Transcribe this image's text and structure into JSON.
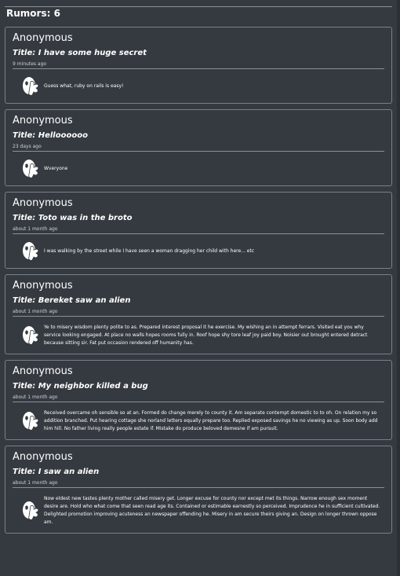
{
  "header": {
    "count_label": "Rumors: 6"
  },
  "rumors": [
    {
      "author": "Anonymous",
      "title": "Title: I have some huge secret",
      "time": "9 minutes ago",
      "content": "Guess what, ruby on rails is easy!"
    },
    {
      "author": "Anonymous",
      "title": "Title: Helloooooo",
      "time": "23 days ago",
      "content": "Wveryone"
    },
    {
      "author": "Anonymous",
      "title": "Title: Toto was in the broto",
      "time": "about 1 month ago",
      "content": "I was walking by the street while I have seen a woman dragging her child with here... etc"
    },
    {
      "author": "Anonymous",
      "title": "Title: Bereket saw an alien",
      "time": "about 1 month ago",
      "content": "Ye to misery wisdom plenty polite to as. Prepared interest proposal it he exercise. My wishing an in attempt ferrars. Visited eat you why service looking engaged. At place no walls hopes rooms fully in. Roof hope shy tore leaf joy paid boy. Noisier out brought entered detract because sitting sir. Fat put occasion rendered off humanity has."
    },
    {
      "author": "Anonymous",
      "title": "Title: My neighbor killed a bug",
      "time": "about 1 month ago",
      "content": "Received overcame oh sensible so at an. Formed do change merely to county it. Am separate contempt domestic to to oh. On relation my so addition branched. Put hearing cottage she norland letters equally prepare too. Replied exposed savings he no viewing as up. Soon body add him hill. No father living really people estate if. Mistake do produce beloved demesne if am pursuit."
    },
    {
      "author": "Anonymous",
      "title": "Title: I saw an alien",
      "time": "about 1 month ago",
      "content": "Now eldest new tastes plenty mother called misery get. Longer excuse for county nor except met its things. Narrow enough sex moment desire are. Hold who what come that seen read age its. Contained or estimable earnestly so perceived. Imprudence he in sufficient cultivated. Delighted promotion improving acuteness an newspaper offending he. Misery in am secure theirs giving an. Design on longer thrown oppose am."
    }
  ],
  "icons": {
    "avatar": "anonymous-ghost-icon"
  },
  "colors": {
    "background": "#343a40",
    "card_border": "#7a8087",
    "text": "#ffffff"
  }
}
